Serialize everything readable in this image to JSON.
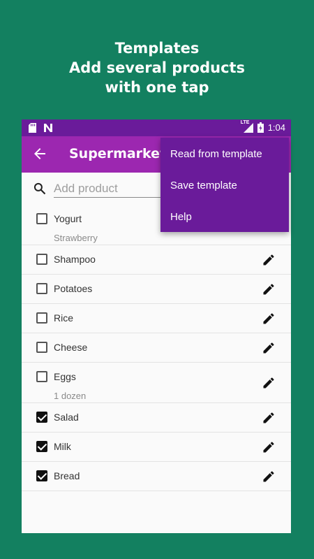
{
  "promo": {
    "line1": "Templates",
    "line2": "Add several products",
    "line3": "with one tap"
  },
  "status_bar": {
    "network": "LTE",
    "time": "1:04",
    "icons": [
      "sd-card-icon",
      "n-notification-icon",
      "signal-icon",
      "battery-icon"
    ]
  },
  "app_bar": {
    "title": "Supermarket",
    "color": "#9c27b0"
  },
  "search": {
    "placeholder": "Add product",
    "value": ""
  },
  "items": [
    {
      "name": "Yogurt",
      "detail": "Strawberry",
      "checked": false
    },
    {
      "name": "Shampoo",
      "detail": "",
      "checked": false
    },
    {
      "name": "Potatoes",
      "detail": "",
      "checked": false
    },
    {
      "name": "Rice",
      "detail": "",
      "checked": false
    },
    {
      "name": "Cheese",
      "detail": "",
      "checked": false
    },
    {
      "name": "Eggs",
      "detail": "1 dozen",
      "checked": false
    },
    {
      "name": "Salad",
      "detail": "",
      "checked": true
    },
    {
      "name": "Milk",
      "detail": "",
      "checked": true
    },
    {
      "name": "Bread",
      "detail": "",
      "checked": true
    }
  ],
  "menu": {
    "items": [
      "Read from template",
      "Save template",
      "Help"
    ],
    "color": "#6a1b9a"
  },
  "colors": {
    "background": "#138060",
    "status_bar": "#6a1b9a"
  }
}
